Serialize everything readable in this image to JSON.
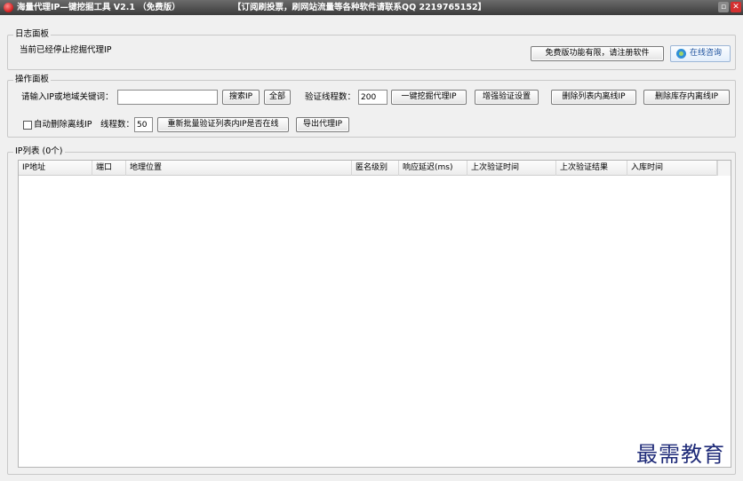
{
  "titlebar": {
    "title": "海量代理IP—键挖掘工具 V2.1 （免费版）",
    "notice": "【订阅刷投票，刷网站流量等各种软件请联系QQ 2219765152】",
    "minimize_glyph": "▫",
    "close_glyph": "✕"
  },
  "log_panel": {
    "title": "日志面板",
    "status": "当前已经停止挖掘代理IP",
    "register_button": "免费版功能有限，请注册软件",
    "consult_button": "在线咨询"
  },
  "operation_panel": {
    "title": "操作面板",
    "keyword_label": "请输入IP或地域关键词：",
    "keyword_value": "",
    "search_button": "搜索IP",
    "all_button": "全部",
    "threads_label": "验证线程数：",
    "threads_value": "200",
    "mine_button": "一键挖掘代理IP",
    "enhanced_verify_button": "增强验证设置",
    "delete_offline_list_button": "删除列表内离线IP",
    "delete_offline_store_button": "删除库存内离线IP",
    "auto_delete_label": "自动删除离线IP",
    "auto_delete_checked": false,
    "thread_count_label": "线程数：",
    "thread_count_value": "50",
    "reverify_button": "重新批量验证列表内IP是否在线",
    "export_button": "导出代理IP"
  },
  "ip_list": {
    "title": "IP列表 (0个)",
    "columns": [
      "IP地址",
      "端口",
      "地理位置",
      "匿名级别",
      "响应延迟(ms)",
      "上次验证时间",
      "上次验证结果",
      "入库时间"
    ],
    "rows": []
  },
  "watermark": "最需教育"
}
